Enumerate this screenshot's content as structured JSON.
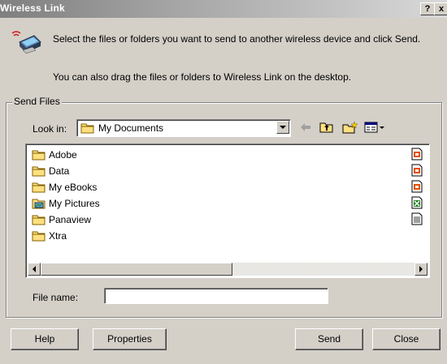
{
  "window": {
    "title": "Wireless Link",
    "help_button": "?",
    "close_button": "x"
  },
  "intro": {
    "line1": "Select the files or folders you want to send to another wireless device and click Send.",
    "line2": "You can also drag the files or folders to Wireless Link on the desktop."
  },
  "group": {
    "label": "Send Files",
    "look_in_label": "Look in:",
    "look_in_value": "My Documents"
  },
  "toolbar": {
    "icons": [
      "back-arrow-icon",
      "up-one-level-icon",
      "new-folder-icon",
      "view-menu-icon"
    ]
  },
  "files": [
    {
      "name": "Adobe",
      "icon": "folder-icon"
    },
    {
      "name": "Data",
      "icon": "folder-icon"
    },
    {
      "name": "My eBooks",
      "icon": "folder-icon"
    },
    {
      "name": "My Pictures",
      "icon": "pictures-folder-icon"
    },
    {
      "name": "Panaview",
      "icon": "folder-icon"
    },
    {
      "name": "Xtra",
      "icon": "folder-icon"
    }
  ],
  "right_files": [
    "powerpoint-file-icon",
    "powerpoint-file-icon",
    "powerpoint-file-icon",
    "excel-file-icon",
    "text-file-icon"
  ],
  "file_name": {
    "label": "File name:",
    "value": ""
  },
  "buttons": {
    "help": "Help",
    "properties": "Properties",
    "send": "Send",
    "close": "Close"
  }
}
